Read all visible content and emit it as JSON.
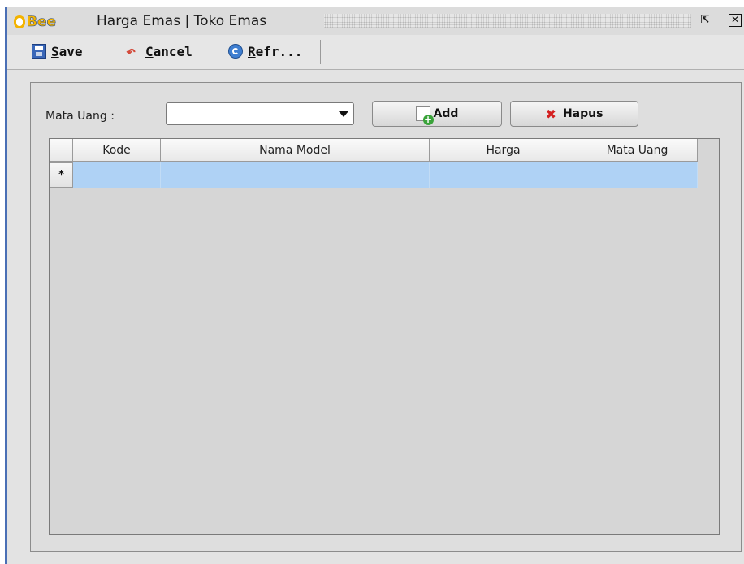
{
  "window": {
    "logo_text": "Bee",
    "title": "Harga Emas | Toko Emas"
  },
  "toolbar": {
    "save": {
      "mnemonic": "S",
      "rest": "ave"
    },
    "cancel": {
      "mnemonic": "C",
      "rest": "ancel"
    },
    "refresh": {
      "mnemonic": "R",
      "rest": "efr..."
    }
  },
  "form": {
    "mata_uang_label": "Mata Uang :",
    "mata_uang_value": "",
    "add_label": "Add",
    "hapus_label": "Hapus"
  },
  "grid": {
    "columns": [
      "",
      "Kode",
      "Nama Model",
      "Harga",
      "Mata Uang"
    ],
    "new_row_marker": "*",
    "rows": []
  },
  "colors": {
    "accent": "#4a6fb5",
    "selection": "#afd2f5",
    "logo": "#f3b300"
  }
}
